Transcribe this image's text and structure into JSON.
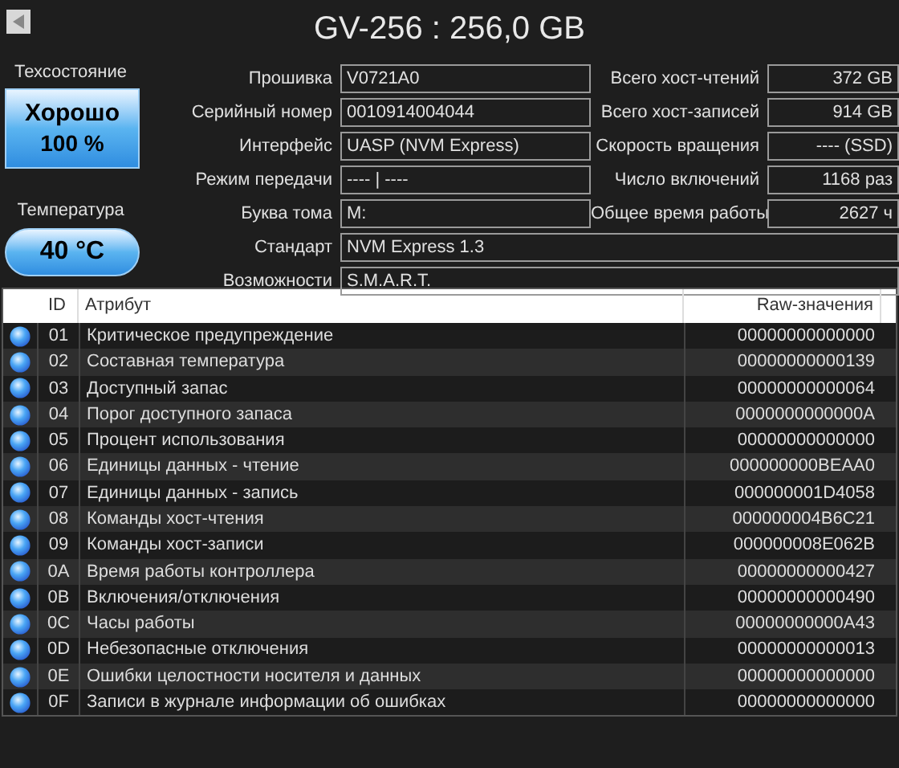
{
  "title": "GV-256 : 256,0 GB",
  "health": {
    "label": "Техсостояние",
    "status": "Хорошо",
    "percent": "100 %"
  },
  "temperature": {
    "label": "Температура",
    "value": "40 °C"
  },
  "info_left": [
    {
      "label": "Прошивка",
      "value": "V0721A0"
    },
    {
      "label": "Серийный номер",
      "value": "0010914004044"
    },
    {
      "label": "Интерфейс",
      "value": "UASP (NVM Express)"
    },
    {
      "label": "Режим передачи",
      "value": "---- | ----"
    },
    {
      "label": "Буква тома",
      "value": "M:"
    }
  ],
  "info_right": [
    {
      "label": "Всего хост-чтений",
      "value": "372 GB"
    },
    {
      "label": "Всего хост-записей",
      "value": "914 GB"
    },
    {
      "label": "Скорость вращения",
      "value": "---- (SSD)"
    },
    {
      "label": "Число включений",
      "value": "1168 раз"
    },
    {
      "label": "Общее время работы",
      "value": "2627 ч"
    }
  ],
  "info_wide": [
    {
      "label": "Стандарт",
      "value": "NVM Express 1.3"
    },
    {
      "label": "Возможности",
      "value": "S.M.A.R.T."
    }
  ],
  "table": {
    "columns": [
      "ID",
      "Атрибут",
      "Raw-значения"
    ],
    "rows": [
      [
        "01",
        "Критическое предупреждение",
        "00000000000000"
      ],
      [
        "02",
        "Составная температура",
        "00000000000139"
      ],
      [
        "03",
        "Доступный запас",
        "00000000000064"
      ],
      [
        "04",
        "Порог доступного запаса",
        "0000000000000A"
      ],
      [
        "05",
        "Процент использования",
        "00000000000000"
      ],
      [
        "06",
        "Единицы данных - чтение",
        "000000000BEAA0"
      ],
      [
        "07",
        "Единицы данных - запись",
        "000000001D4058"
      ],
      [
        "08",
        "Команды хост-чтения",
        "000000004B6C21"
      ],
      [
        "09",
        "Команды хост-записи",
        "000000008E062B"
      ],
      [
        "0A",
        "Время работы контроллера",
        "00000000000427"
      ],
      [
        "0B",
        "Включения/отключения",
        "00000000000490"
      ],
      [
        "0C",
        "Часы работы",
        "00000000000A43"
      ],
      [
        "0D",
        "Небезопасные отключения",
        "00000000000013"
      ],
      [
        "0E",
        "Ошибки целостности носителя и данных",
        "00000000000000"
      ],
      [
        "0F",
        "Записи в журнале информации об ошибках",
        "00000000000000"
      ]
    ]
  }
}
